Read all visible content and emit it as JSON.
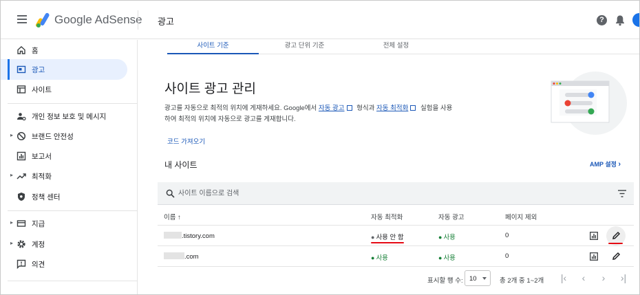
{
  "app": {
    "brand": "Google AdSense",
    "page_title": "광고"
  },
  "header": {
    "help_icon": "help-icon",
    "notification_icon": "bell-icon"
  },
  "sidebar": {
    "items": [
      {
        "label": "홈",
        "icon": "home-icon"
      },
      {
        "label": "광고",
        "icon": "ads-icon",
        "active": true
      },
      {
        "label": "사이트",
        "icon": "sites-icon"
      },
      {
        "label": "개인 정보 보호 및 메시지",
        "icon": "privacy-icon"
      },
      {
        "label": "브랜드 안전성",
        "icon": "block-icon",
        "expandable": true
      },
      {
        "label": "보고서",
        "icon": "reports-icon"
      },
      {
        "label": "최적화",
        "icon": "trending-icon",
        "expandable": true
      },
      {
        "label": "정책 센터",
        "icon": "policy-icon"
      },
      {
        "label": "지급",
        "icon": "payments-icon",
        "expandable": true
      },
      {
        "label": "계정",
        "icon": "gear-icon",
        "expandable": true
      },
      {
        "label": "의견",
        "icon": "feedback-icon"
      }
    ]
  },
  "tabs": [
    {
      "label": "사이트 기준",
      "active": true
    },
    {
      "label": "광고 단위 기준"
    },
    {
      "label": "전체 설정"
    }
  ],
  "main": {
    "heading": "사이트 광고 관리",
    "desc_1": "광고를 자동으로 최적의 위치에 게재하세요. Google에서 ",
    "desc_link_1": "자동 광고",
    "desc_2": " 형식과 ",
    "desc_link_2": "자동 최적화",
    "desc_3": " 실험을 사용하여 최적의 위치에 자동으로 광고를 게재합니다.",
    "code_link": "코드 가져오기",
    "my_sites": "내 사이트",
    "amp_link": "AMP 설정"
  },
  "search": {
    "placeholder": "사이트 이름으로 검색"
  },
  "table": {
    "columns": [
      "이름 ↑",
      "자동 최적화",
      "자동 광고",
      "페이지 제외"
    ],
    "rows": [
      {
        "name": ".tistory.com",
        "auto_opt": "사용 안 함",
        "auto_ads": "사용",
        "excluded": "0"
      },
      {
        "name": ".com",
        "auto_opt": "사용",
        "auto_ads": "사용",
        "excluded": "0"
      }
    ]
  },
  "footer": {
    "rows_label": "표시할 행 수:",
    "rows_value": "10",
    "range": "총 2개 중 1~2개"
  },
  "colors": {
    "accent": "#1a57b7",
    "active_bg": "#e8f0fe",
    "success": "#188038",
    "highlight": "#e50914"
  }
}
